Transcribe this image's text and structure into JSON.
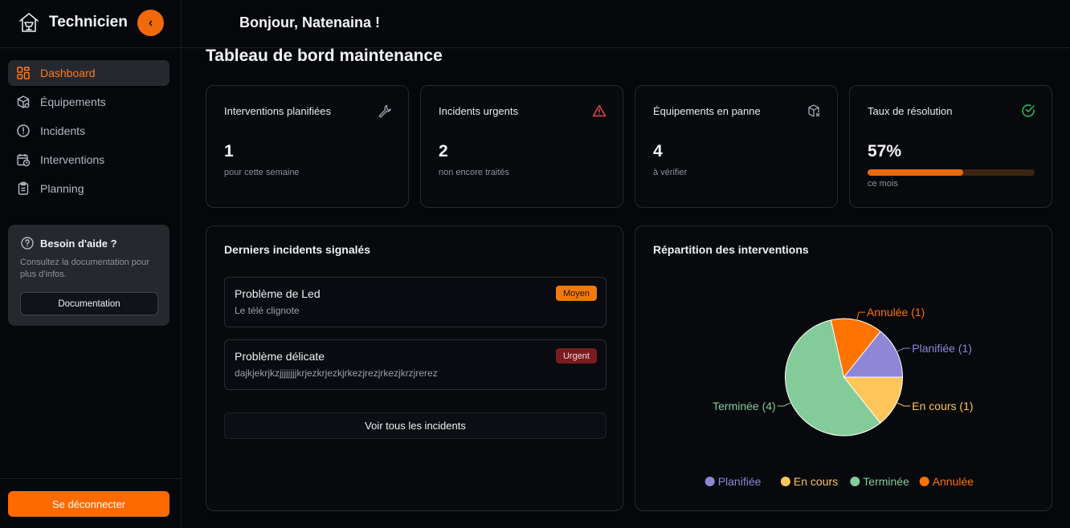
{
  "brand": {
    "title": "Technicien",
    "collapse_icon": "‹"
  },
  "nav": [
    {
      "label": "Dashboard",
      "icon": "dashboard-icon",
      "active": true
    },
    {
      "label": "Équipements",
      "icon": "equipment-icon",
      "active": false
    },
    {
      "label": "Incidents",
      "icon": "alert-circle-icon",
      "active": false
    },
    {
      "label": "Interventions",
      "icon": "calendar-clock-icon",
      "active": false
    },
    {
      "label": "Planning",
      "icon": "clipboard-icon",
      "active": false
    }
  ],
  "help": {
    "title": "Besoin d'aide ?",
    "text": "Consultez la documentation pour plus d'infos.",
    "button": "Documentation"
  },
  "logout": "Se déconnecter",
  "header": {
    "greeting": "Bonjour, Natenaina !"
  },
  "page_title": "Tableau de bord maintenance",
  "stats": [
    {
      "label": "Interventions planifiées",
      "value": "1",
      "sub": "pour cette semaine",
      "icon": "wrench-icon"
    },
    {
      "label": "Incidents urgents",
      "value": "2",
      "sub": "non encore traités",
      "icon": "warning-icon"
    },
    {
      "label": "Équipements en panne",
      "value": "4",
      "sub": "à vérifier",
      "icon": "broken-box-icon"
    },
    {
      "label": "Taux de résolution",
      "value": "57%",
      "sub": "ce mois",
      "icon": "check-circle-icon",
      "progress": 0.57
    }
  ],
  "incidents_panel": {
    "title": "Derniers incidents signalés",
    "items": [
      {
        "title": "Problème de Led",
        "desc": "Le télé clignote",
        "badge": "Moyen"
      },
      {
        "title": "Problème délicate",
        "desc": "dajkjekrjkzjjjjjjjjkrjezkrjezkjrkezjrezjrkezjkrzjrerez",
        "badge": "Urgent"
      }
    ],
    "see_all": "Voir tous les incidents"
  },
  "chart_data": {
    "type": "pie",
    "title": "Répartition des interventions",
    "slices": [
      {
        "name": "Planifiée",
        "value": 1,
        "label": "Planifiée (1)",
        "color": "#8f87d6"
      },
      {
        "name": "Annulée",
        "value": 1,
        "label": "Annulée (1)",
        "color": "#ff7300"
      },
      {
        "name": "Terminée",
        "value": 4,
        "label": "Terminée (4)",
        "color": "#84cb9a"
      },
      {
        "name": "En cours",
        "value": 1,
        "label": "En cours (1)",
        "color": "#fec55a"
      }
    ],
    "legend": [
      "Planifiée",
      "En cours",
      "Terminée",
      "Annulée"
    ],
    "legend_position": "bottom"
  }
}
